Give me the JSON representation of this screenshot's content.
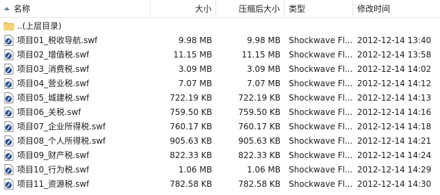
{
  "columns": {
    "name": "名称",
    "size": "大小",
    "compressed": "压缩后大小",
    "type": "类型",
    "modified": "修改时间"
  },
  "parent_row": {
    "name": "..(上层目录)"
  },
  "files": [
    {
      "name": "项目01_税收导航.swf",
      "size": "9.98 MB",
      "compressed": "9.98 MB",
      "type": "Shockwave Fl...",
      "modified": "2012-12-14 13:40"
    },
    {
      "name": "项目02_增值税.swf",
      "size": "11.15 MB",
      "compressed": "11.15 MB",
      "type": "Shockwave Fl...",
      "modified": "2012-12-14 13:58"
    },
    {
      "name": "项目03_消费税.swf",
      "size": "3.09 MB",
      "compressed": "3.09 MB",
      "type": "Shockwave Fl...",
      "modified": "2012-12-14 14:02"
    },
    {
      "name": "项目04_营业税.swf",
      "size": "7.07 MB",
      "compressed": "7.07 MB",
      "type": "Shockwave Fl...",
      "modified": "2012-12-14 14:12"
    },
    {
      "name": "项目05_城建税.swf",
      "size": "722.19 KB",
      "compressed": "722.19 KB",
      "type": "Shockwave Fl...",
      "modified": "2012-12-14 14:13"
    },
    {
      "name": "项目06_关税.swf",
      "size": "759.50 KB",
      "compressed": "759.50 KB",
      "type": "Shockwave Fl...",
      "modified": "2012-12-14 14:16"
    },
    {
      "name": "项目07_企业所得税.swf",
      "size": "760.17 KB",
      "compressed": "760.17 KB",
      "type": "Shockwave Fl...",
      "modified": "2012-12-14 14:18"
    },
    {
      "name": "项目08_个人所得税.swf",
      "size": "905.63 KB",
      "compressed": "905.63 KB",
      "type": "Shockwave Fl...",
      "modified": "2012-12-14 14:21"
    },
    {
      "name": "项目09_财产税.swf",
      "size": "822.33 KB",
      "compressed": "822.33 KB",
      "type": "Shockwave Fl...",
      "modified": "2012-12-14 14:24"
    },
    {
      "name": "项目10_行为税.swf",
      "size": "1.06 MB",
      "compressed": "1.06 MB",
      "type": "Shockwave Fl...",
      "modified": "2012-12-14 14:29"
    },
    {
      "name": "项目11_资源税.swf",
      "size": "782.58 KB",
      "compressed": "782.58 KB",
      "type": "Shockwave Fl...",
      "modified": "2012-12-14 14:30"
    }
  ],
  "icons": {
    "sort": "sort-ascending-icon",
    "folder": "folder-icon",
    "file": "shockwave-flash-file-icon"
  },
  "colors": {
    "header_border": "#e5e5e5",
    "sort_arrow": "#5a7fa8",
    "folder": "#f3c45a",
    "file_icon": "#2a4f8f"
  }
}
